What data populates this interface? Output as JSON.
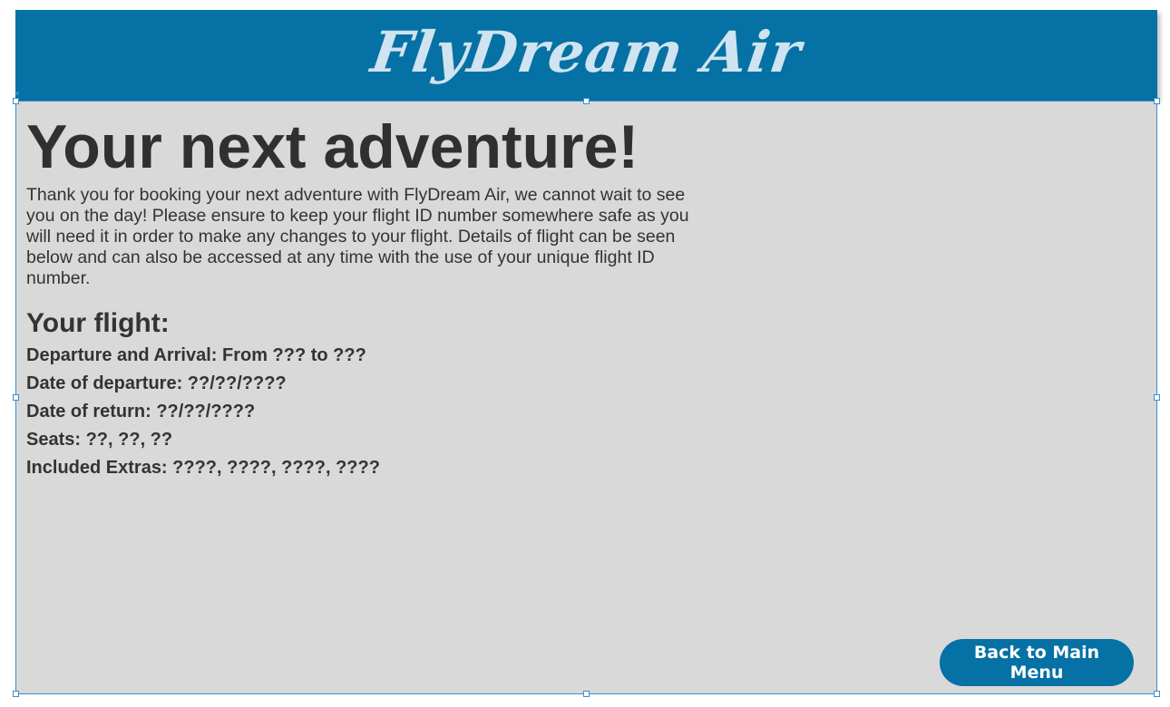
{
  "header": {
    "brand": "FlyDream Air"
  },
  "main": {
    "headline": "Your next adventure!",
    "intro": "Thank you for booking your next adventure with FlyDream Air, we cannot wait to see you on the day! Please ensure to keep your flight ID number somewhere safe as you will need it in order to make any changes to your flight. Details of flight can be seen below and can also be accessed at any time with the use of your unique flight ID number.",
    "flight_title": "Your flight:",
    "details": [
      "Departure and Arrival: From ??? to ???",
      "Date of departure: ??/??/????",
      "Date of return: ??/??/????",
      "Seats: ??, ??, ??",
      "Included Extras: ????, ????, ????, ????"
    ]
  },
  "buttons": {
    "back_label": "Back to Main Menu"
  },
  "colors": {
    "header_bg": "#0571a4",
    "brand_text": "#cfe3f0",
    "panel_bg": "#d9d9d9",
    "button_bg": "#0571a4",
    "button_text": "#ffffff",
    "selection_outline": "#3a8fd0"
  }
}
